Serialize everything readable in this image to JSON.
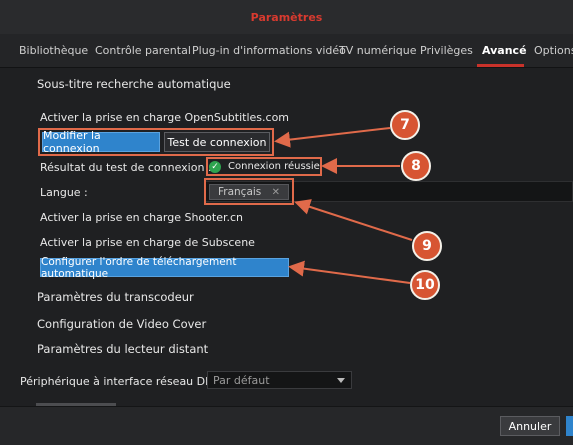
{
  "window": {
    "title": "Paramètres"
  },
  "tabs": [
    {
      "label": "Bibliothèque"
    },
    {
      "label": "Contrôle parental"
    },
    {
      "label": "Plug-in d'informations vidéo"
    },
    {
      "label": "TV numérique"
    },
    {
      "label": "Privilèges"
    },
    {
      "label": "Avancé"
    },
    {
      "label": "Options"
    }
  ],
  "active_tab": "Avancé",
  "subtitles": {
    "section_title": "Sous-titre recherche automatique",
    "opensubtitles_label": "Activer la prise en charge OpenSubtitles.com",
    "modify_connection_label": "Modifier la connexion",
    "test_connection_label": "Test de connexion",
    "test_result_label": "Résultat du test de connexion :",
    "test_result_value": "Connexion réussie",
    "language_label": "Langue :",
    "language_chip": "Français",
    "chip_remove_glyph": "✕",
    "shooter_label": "Activer la prise en charge Shooter.cn",
    "subscene_label": "Activer la prise en charge de Subscene",
    "configure_order_label": "Configurer l'ordre de téléchargement automatique"
  },
  "sections": {
    "transcoder": "Paramètres du transcodeur",
    "videocover": "Configuration de Video Cover",
    "remote_player": "Paramètres du lecteur distant"
  },
  "dlna": {
    "label": "Périphérique à interface réseau DLNA :",
    "selected": "Par défaut"
  },
  "footer": {
    "cancel_label": "Annuler"
  },
  "annotations": [
    {
      "number": "7"
    },
    {
      "number": "8"
    },
    {
      "number": "9"
    },
    {
      "number": "10"
    }
  ],
  "colors": {
    "title_red": "#d83a2f",
    "tab_underline": "#c9322a",
    "primary_blue": "#2f84cc",
    "success_green": "#2ea44f",
    "annotation_orange": "#d75532"
  }
}
